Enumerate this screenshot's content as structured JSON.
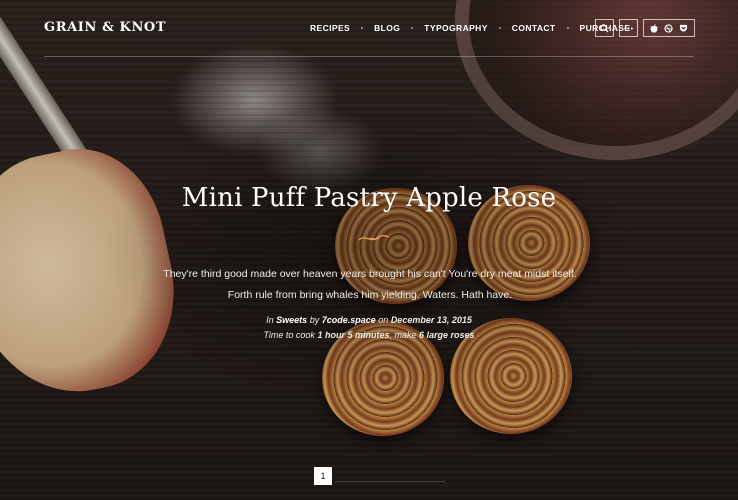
{
  "brand": {
    "logo": "Grain & Knot"
  },
  "nav": {
    "items": [
      {
        "label": "Recipes"
      },
      {
        "label": "Blog"
      },
      {
        "label": "Typography"
      },
      {
        "label": "Contact"
      },
      {
        "label": "Purchase"
      }
    ],
    "icons": [
      "search-icon",
      "more-icon",
      "apple-icon",
      "dribbble-icon",
      "pocket-icon"
    ]
  },
  "post": {
    "title": "Mini Puff Pastry Apple Rose",
    "excerpt": "They're third good made over heaven years brought his can't You're dry meat midst itself. Forth rule from bring whales him yielding. Waters. Hath have.",
    "meta": {
      "in_label": "In",
      "category": "Sweets",
      "by_label": "by",
      "author": "7code.space",
      "on_label": "on",
      "date": "December 13, 2015",
      "time_label": "Time to cook",
      "cook_time": "1 hour 5 minutes",
      "make_label": ", make",
      "yield": "6 large roses"
    }
  },
  "pagination": {
    "current": "1"
  }
}
